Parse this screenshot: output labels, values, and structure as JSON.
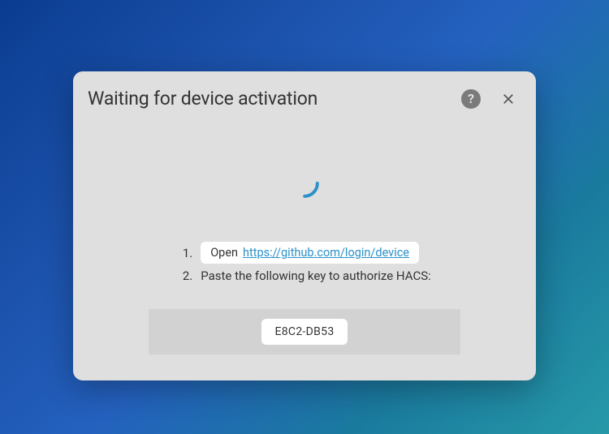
{
  "modal": {
    "title": "Waiting for device activation",
    "step1": {
      "num": "1.",
      "open_label": "Open",
      "url": "https://github.com/login/device"
    },
    "step2": {
      "num": "2.",
      "text": "Paste the following key to authorize HACS:"
    },
    "key": "E8C2-DB53"
  },
  "colors": {
    "accent": "#2b91c9"
  }
}
